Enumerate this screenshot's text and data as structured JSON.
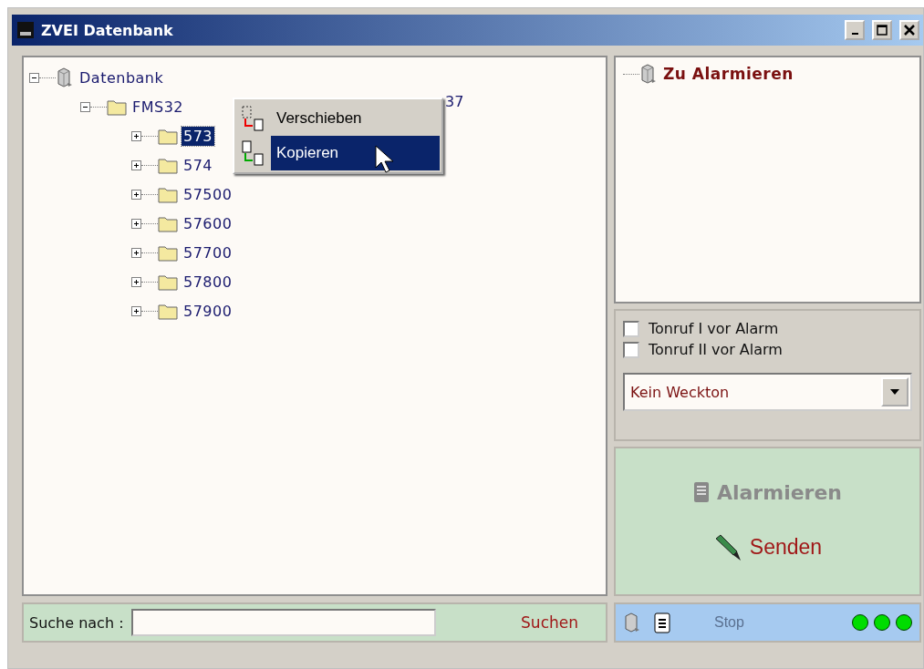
{
  "window": {
    "title": "ZVEI Datenbank"
  },
  "tree": [
    {
      "label": "Datenbank",
      "kind": "database",
      "expanded": true,
      "children": [
        {
          "label": "FMS32",
          "kind": "folder",
          "expanded": true,
          "children": [
            {
              "label": "573",
              "kind": "folder",
              "expanded": false,
              "selected": true
            },
            {
              "label": "574",
              "kind": "folder",
              "expanded": false,
              "selected": false
            },
            {
              "label": "57500",
              "kind": "folder",
              "expanded": false,
              "selected": false
            },
            {
              "label": "57600",
              "kind": "folder",
              "expanded": false,
              "selected": false
            },
            {
              "label": "57700",
              "kind": "folder",
              "expanded": false,
              "selected": false
            },
            {
              "label": "57800",
              "kind": "folder",
              "expanded": false,
              "selected": false
            },
            {
              "label": "57900",
              "kind": "folder",
              "expanded": false,
              "selected": false
            }
          ]
        }
      ]
    }
  ],
  "hidden_label_tail": "37",
  "context_menu": [
    {
      "label": "Verschieben",
      "kind": "move",
      "selected": false
    },
    {
      "label": "Kopieren",
      "kind": "copy",
      "selected": true
    }
  ],
  "target_tree": {
    "label": "Zu Alarmieren"
  },
  "options": [
    {
      "label": "Tonruf I vor Alarm",
      "checked": false
    },
    {
      "label": "Tonruf II vor Alarm",
      "checked": false
    }
  ],
  "tone_select": {
    "value": "Kein Weckton"
  },
  "actions": [
    {
      "label": "Alarmieren",
      "kind": "alarm",
      "disabled": true
    },
    {
      "label": "Senden",
      "kind": "send",
      "disabled": false
    }
  ],
  "search": {
    "label": "Suche nach :",
    "button": "Suchen"
  },
  "status": {
    "stop": "Stop",
    "stop_disabled": true,
    "lights": [
      {
        "color": "#00dd00"
      },
      {
        "color": "#00dd00"
      },
      {
        "color": "#00dd00"
      }
    ]
  }
}
